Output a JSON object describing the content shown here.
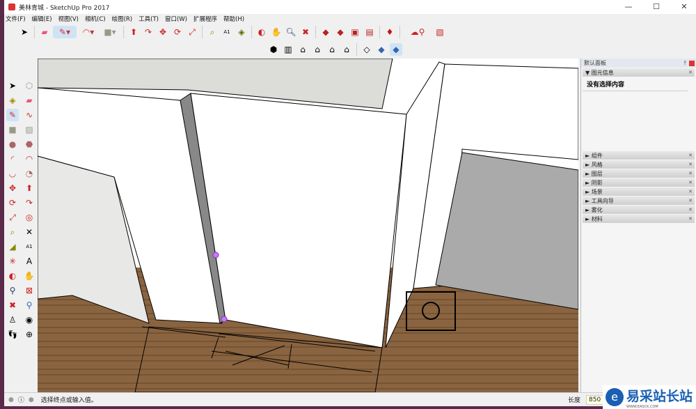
{
  "window": {
    "title": "美林青城 - SketchUp Pro 2017",
    "minimize": "—",
    "maximize": "☐",
    "close": "✕"
  },
  "menu": [
    "文件(F)",
    "编辑(E)",
    "视图(V)",
    "相机(C)",
    "绘图(R)",
    "工具(T)",
    "窗口(W)",
    "扩展程序",
    "帮助(H)"
  ],
  "toolbar_icons": [
    "select",
    "eraser",
    "pencil",
    "arc",
    "rectangle",
    "push-pull",
    "follow-me",
    "move",
    "rotate",
    "scale",
    "tape-measure",
    "text",
    "orbit",
    "paint-bucket",
    "zoom",
    "zoom-extents",
    "warehouse",
    "extension-warehouse",
    "share-model",
    "layout",
    "ruby",
    "3d-warehouse",
    "send-to-layout"
  ],
  "view_icons": [
    "iso",
    "top",
    "front",
    "right",
    "back",
    "left",
    "parallel",
    "perspective",
    "xray"
  ],
  "panel": {
    "title": "默认面板",
    "entity_info": "图元信息",
    "no_selection": "没有选择内容",
    "sections": [
      "组件",
      "风格",
      "图层",
      "阴影",
      "场景",
      "工具向导",
      "雾化",
      "材料"
    ]
  },
  "status": {
    "hint": "选择终点或输入值。",
    "length_label": "长度",
    "length_value": "850"
  },
  "watermark": {
    "text": "易采站长站",
    "sub": "WWW.EASCK.COM"
  }
}
